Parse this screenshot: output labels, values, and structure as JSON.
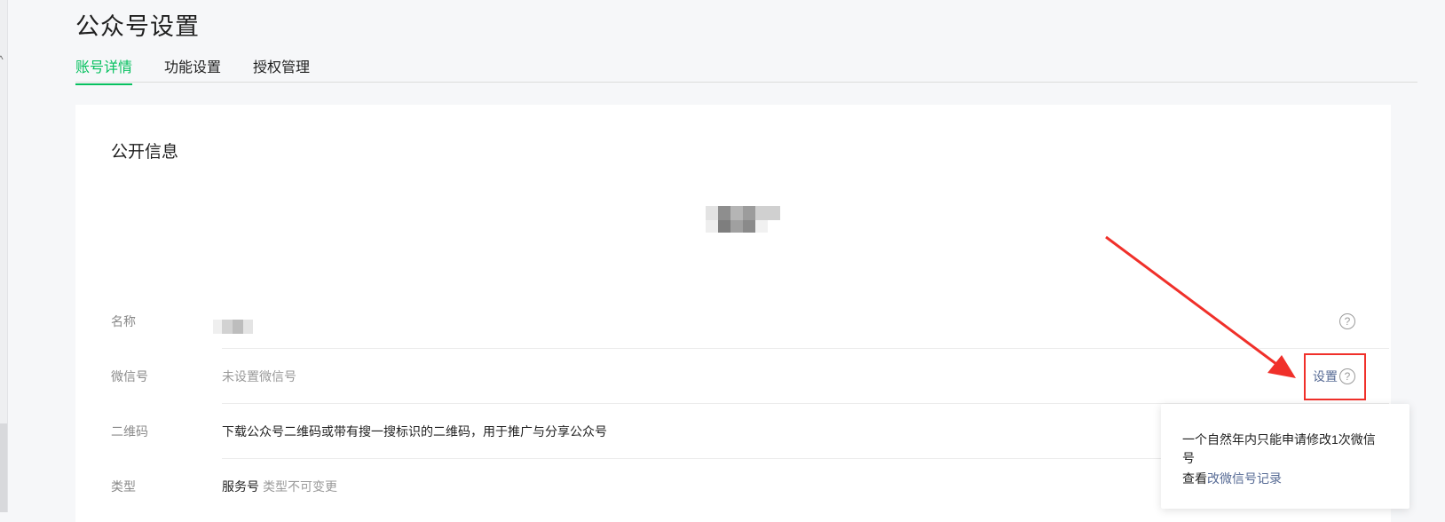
{
  "page": {
    "title": "公众号设置"
  },
  "tabs": [
    {
      "label": "账号详情",
      "active": true
    },
    {
      "label": "功能设置",
      "active": false
    },
    {
      "label": "授权管理",
      "active": false
    }
  ],
  "card": {
    "section_title": "公开信息",
    "rows": {
      "name": {
        "label": "名称"
      },
      "wechat_id": {
        "label": "微信号",
        "value": "未设置微信号",
        "action": "设置"
      },
      "qrcode": {
        "label": "二维码",
        "value": "下载公众号二维码或带有搜一搜标识的二维码，用于推广与分享公众号"
      },
      "type": {
        "label": "类型",
        "value": "服务号",
        "note": "类型不可变更"
      }
    }
  },
  "popover": {
    "text": "一个自然年内只能申请修改1次微信号",
    "prefix": "查看",
    "link": "改微信号记录"
  },
  "icons": {
    "help": "help-circle-icon",
    "caret": "caret-up-icon"
  },
  "colors": {
    "accent": "#07c160",
    "link": "#576b95",
    "annotation_red": "#f0302a"
  }
}
